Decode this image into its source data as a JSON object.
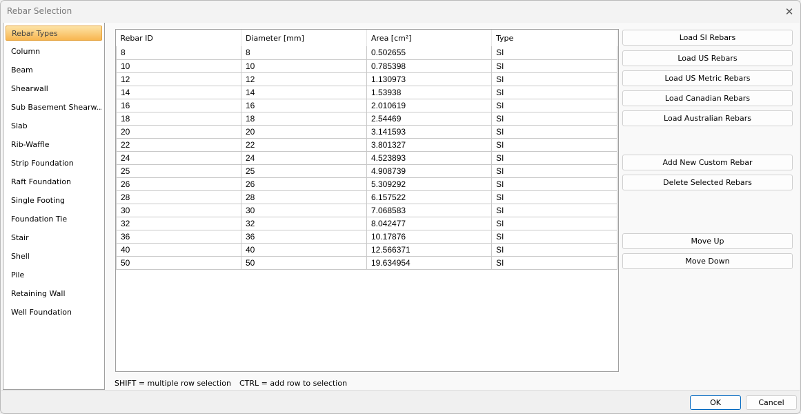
{
  "window": {
    "title": "Rebar Selection",
    "close_icon": "close-icon"
  },
  "sidebar": {
    "items": [
      {
        "label": "Rebar Types",
        "active": true
      },
      {
        "label": "Column"
      },
      {
        "label": "Beam"
      },
      {
        "label": "Shearwall"
      },
      {
        "label": "Sub Basement Shearw..."
      },
      {
        "label": "Slab"
      },
      {
        "label": "Rib-Waffle"
      },
      {
        "label": "Strip Foundation"
      },
      {
        "label": "Raft Foundation"
      },
      {
        "label": "Single Footing"
      },
      {
        "label": "Foundation Tie"
      },
      {
        "label": "Stair"
      },
      {
        "label": "Shell"
      },
      {
        "label": "Pile"
      },
      {
        "label": "Retaining Wall"
      },
      {
        "label": "Well Foundation"
      }
    ]
  },
  "table": {
    "columns": [
      "Rebar ID",
      "Diameter [mm]",
      "Area [cm²]",
      "Type"
    ],
    "rows": [
      [
        "8",
        "8",
        "0.502655",
        "SI"
      ],
      [
        "10",
        "10",
        "0.785398",
        "SI"
      ],
      [
        "12",
        "12",
        "1.130973",
        "SI"
      ],
      [
        "14",
        "14",
        "1.53938",
        "SI"
      ],
      [
        "16",
        "16",
        "2.010619",
        "SI"
      ],
      [
        "18",
        "18",
        "2.54469",
        "SI"
      ],
      [
        "20",
        "20",
        "3.141593",
        "SI"
      ],
      [
        "22",
        "22",
        "3.801327",
        "SI"
      ],
      [
        "24",
        "24",
        "4.523893",
        "SI"
      ],
      [
        "25",
        "25",
        "4.908739",
        "SI"
      ],
      [
        "26",
        "26",
        "5.309292",
        "SI"
      ],
      [
        "28",
        "28",
        "6.157522",
        "SI"
      ],
      [
        "30",
        "30",
        "7.068583",
        "SI"
      ],
      [
        "32",
        "32",
        "8.042477",
        "SI"
      ],
      [
        "36",
        "36",
        "10.17876",
        "SI"
      ],
      [
        "40",
        "40",
        "12.566371",
        "SI"
      ],
      [
        "50",
        "50",
        "19.634954",
        "SI"
      ]
    ]
  },
  "hints": {
    "shift": "SHIFT = multiple row selection",
    "ctrl": "CTRL = add row to selection"
  },
  "buttons": {
    "load_si": "Load SI Rebars",
    "load_us": "Load US Rebars",
    "load_us_metric": "Load US Metric Rebars",
    "load_canadian": "Load Canadian Rebars",
    "load_australian": "Load Australian Rebars",
    "add_custom": "Add New Custom Rebar",
    "delete_selected": "Delete Selected Rebars",
    "move_up": "Move Up",
    "move_down": "Move Down",
    "ok": "OK",
    "cancel": "Cancel"
  },
  "colors": {
    "active_item": "#f8b650",
    "ok_border": "#0067c0"
  }
}
